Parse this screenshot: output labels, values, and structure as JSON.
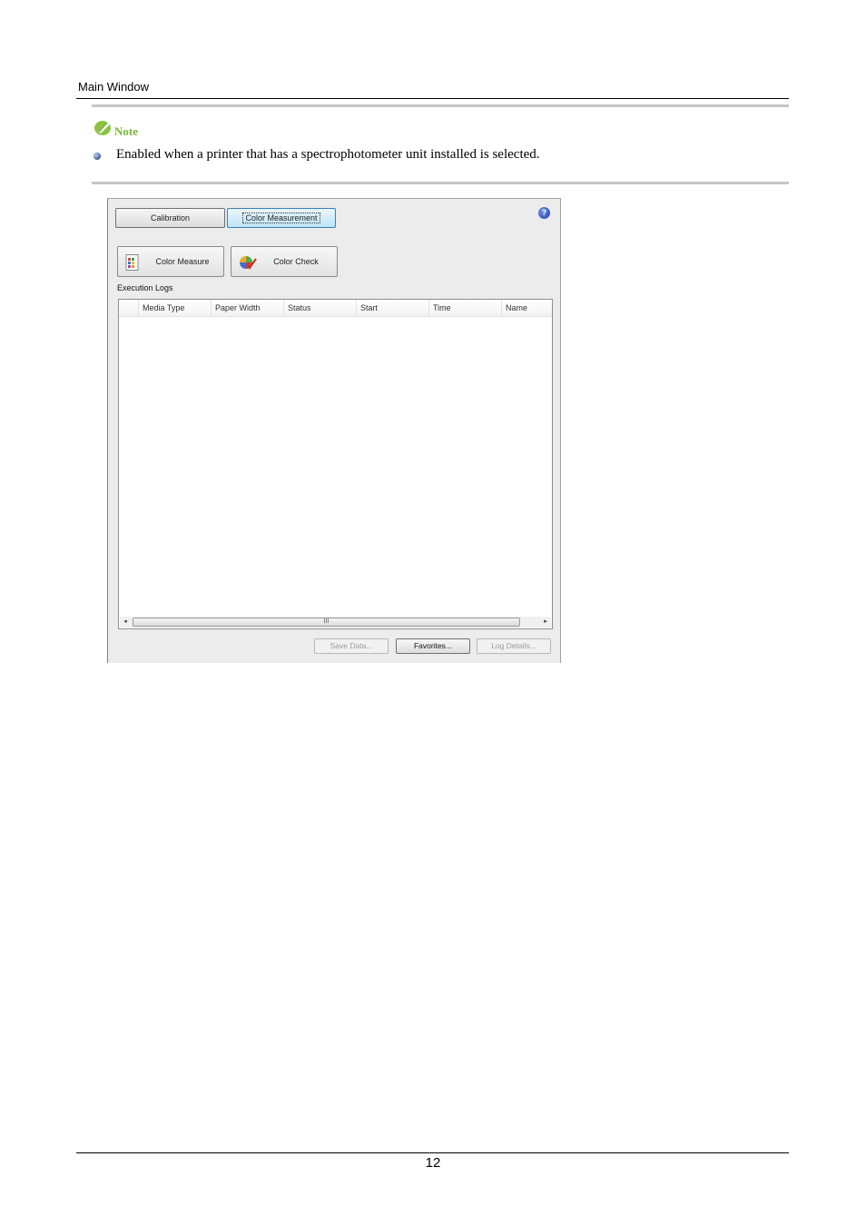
{
  "header": {
    "title": "Main Window"
  },
  "note": {
    "title": "Note",
    "items": [
      "Enabled when a printer that has a spectrophotometer unit installed is selected."
    ]
  },
  "app": {
    "tabs": {
      "calibration": "Calibration",
      "color_measurement": "Color Measurement",
      "active": "color_measurement"
    },
    "buttons": {
      "color_measure": "Color Measure",
      "color_check": "Color Check"
    },
    "help_glyph": "?",
    "execution_logs": {
      "label": "Execution Logs",
      "columns": [
        "Media Type",
        "Paper Width",
        "Status",
        "Start",
        "Time",
        "Name"
      ],
      "rows": []
    },
    "scrollbar": {
      "left_arrow": "◂",
      "right_arrow": "▸",
      "grip": "III"
    },
    "footer_buttons": {
      "save_data": "Save Data...",
      "favorites": "Favorites...",
      "log_details": "Log Details..."
    }
  },
  "footer": {
    "page_number": "12"
  },
  "colors": {
    "note_green": "#7ab43a",
    "active_tab": "#bfe4f8",
    "rule_gray": "#c6c6c6"
  },
  "icons": [
    "note-pencil-icon",
    "bullet-icon",
    "help-icon",
    "color-measure-icon",
    "color-check-icon"
  ]
}
